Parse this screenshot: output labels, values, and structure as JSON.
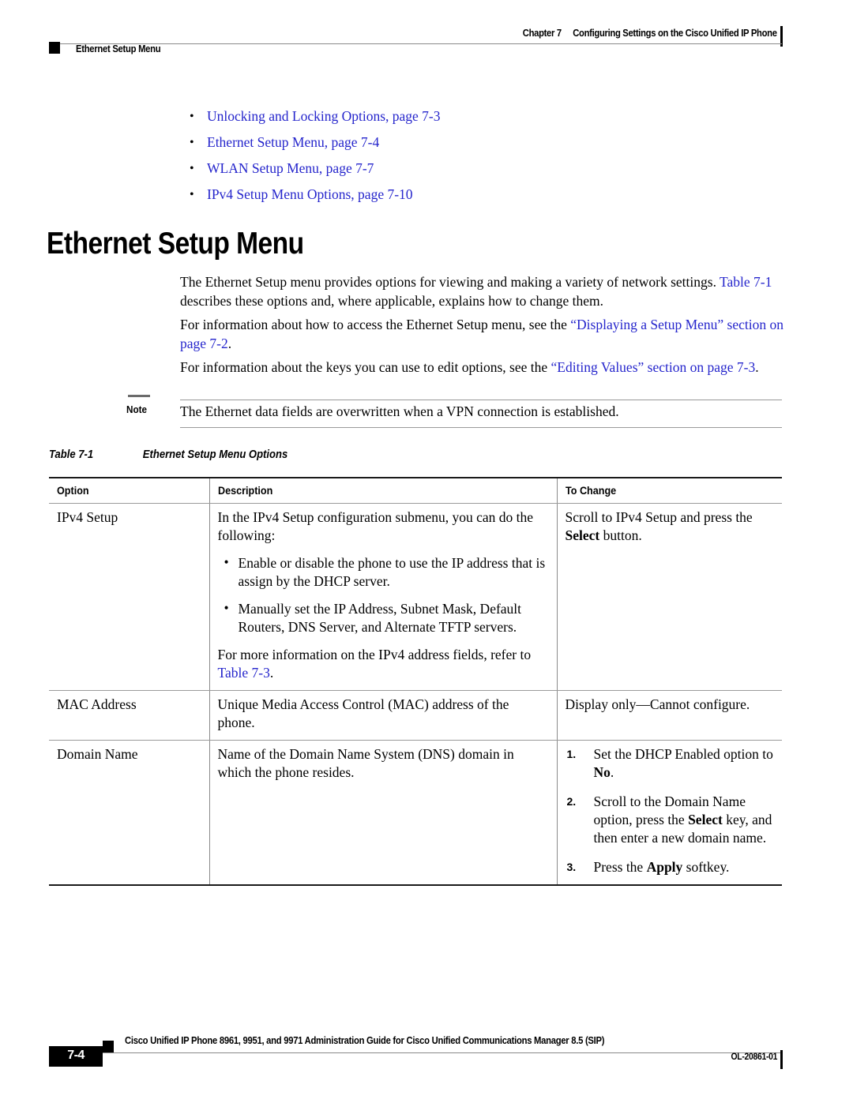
{
  "header": {
    "chapter_number": "Chapter 7",
    "chapter_title": "Configuring Settings on the Cisco Unified IP Phone",
    "section": "Ethernet Setup Menu"
  },
  "crosslinks": [
    {
      "text": "Unlocking and Locking Options, page 7-3"
    },
    {
      "text": "Ethernet Setup Menu, page 7-4"
    },
    {
      "text": "WLAN Setup Menu, page 7-7"
    },
    {
      "text": "IPv4 Setup Menu Options, page 7-10"
    }
  ],
  "heading": "Ethernet Setup Menu",
  "paragraphs": {
    "p1_a": "The Ethernet Setup menu provides options for viewing and making a variety of network settings. ",
    "p1_link": "Table 7-1",
    "p1_b": " describes these options and, where applicable, explains how to change them.",
    "p2_a": "For information about how to access the Ethernet Setup menu, see the ",
    "p2_link": "“Displaying a Setup Menu” section on page 7-2",
    "p2_b": ".",
    "p3_a": "For information about the keys you can use to edit options, see the ",
    "p3_link": "“Editing Values” section on page 7-3",
    "p3_b": "."
  },
  "note": {
    "label": "Note",
    "text": "The Ethernet data fields are overwritten when a VPN connection is established."
  },
  "table_caption": {
    "number": "Table 7-1",
    "title": "Ethernet Setup Menu Options"
  },
  "table": {
    "headers": [
      "Option",
      "Description",
      "To Change"
    ],
    "rows": [
      {
        "option": "IPv4 Setup",
        "desc_intro": "In the IPv4 Setup configuration submenu, you can do the following:",
        "desc_bullets": [
          "Enable or disable the phone to use the IP address that is assign by the DHCP server.",
          "Manually set the IP Address, Subnet Mask, Default Routers, DNS Server, and Alternate TFTP servers."
        ],
        "desc_outro_a": "For more information on the IPv4 address fields, refer to ",
        "desc_outro_link": "Table 7-3",
        "desc_outro_b": ".",
        "change_a": "Scroll to IPv4 Setup and press the ",
        "change_bold": "Select",
        "change_b": " button."
      },
      {
        "option": "MAC Address",
        "desc": "Unique Media Access Control (MAC) address of the phone.",
        "change": "Display only—Cannot configure."
      },
      {
        "option": "Domain Name",
        "desc": "Name of the Domain Name System (DNS) domain in which the phone resides.",
        "steps": [
          {
            "n": "1.",
            "a": "Set the DHCP Enabled option to ",
            "bold": "No",
            "b": "."
          },
          {
            "n": "2.",
            "a": "Scroll to the Domain Name option, press the ",
            "bold": "Select",
            "b": " key, and then enter a new domain name."
          },
          {
            "n": "3.",
            "a": "Press the ",
            "bold": "Apply",
            "b": " softkey."
          }
        ]
      }
    ]
  },
  "footer": {
    "page_number": "7-4",
    "guide_title": "Cisco Unified IP Phone 8961, 9951, and 9971 Administration Guide for Cisco Unified Communications Manager 8.5 (SIP)",
    "doc_id": "OL-20861-01"
  },
  "colors": {
    "link": "#2525cc",
    "rule": "#8a8a8a",
    "text": "#000000"
  }
}
